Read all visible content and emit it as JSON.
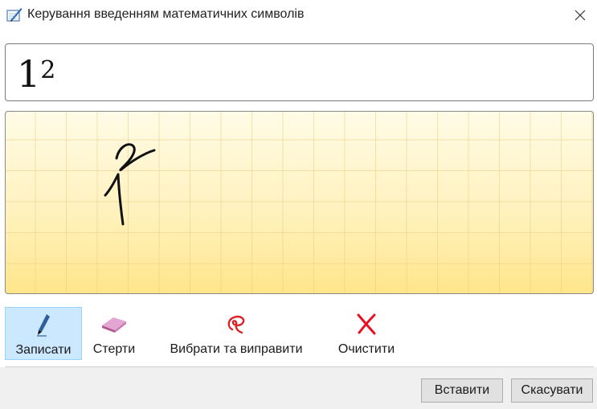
{
  "window": {
    "title": "Керування введенням математичних символів",
    "icon": "math-input-icon",
    "close_icon": "close-icon"
  },
  "preview": {
    "base": "1",
    "exponent": "2"
  },
  "writing_pad": {
    "ink_text": "1²",
    "ink_color": "#111111",
    "grid_color": "#e8cd82",
    "background_top": "#fffbe6",
    "background_bottom": "#ffe58a"
  },
  "tools": [
    {
      "label": "Записати",
      "icon": "pen-icon",
      "active": true
    },
    {
      "label": "Стерти",
      "icon": "eraser-icon",
      "active": false
    },
    {
      "label": "Вибрати та виправити",
      "icon": "lasso-icon",
      "active": false
    },
    {
      "label": "Очистити",
      "icon": "clear-x-icon",
      "active": false
    }
  ],
  "buttons": {
    "insert": "Вставити",
    "cancel": "Скасувати"
  },
  "colors": {
    "active_tool_bg": "#cce8ff",
    "clear_red": "#e81123",
    "lasso_red": "#d9242a",
    "eraser_pink": "#c878b4"
  }
}
